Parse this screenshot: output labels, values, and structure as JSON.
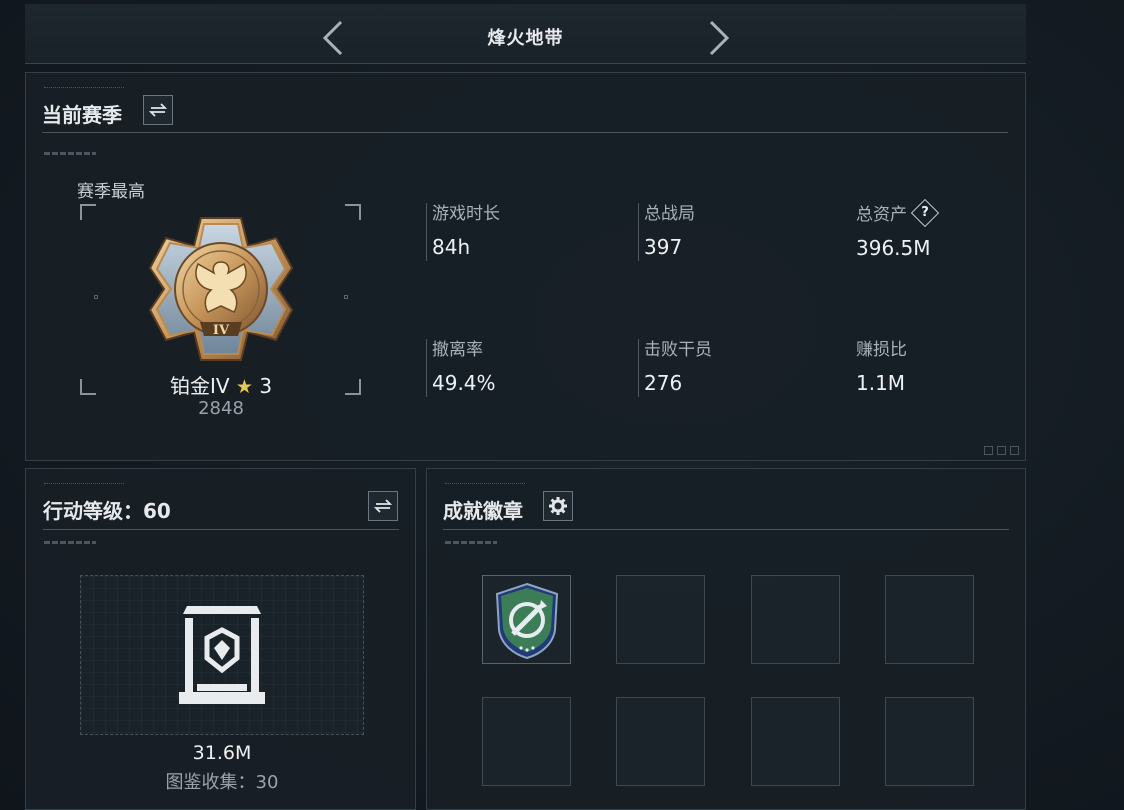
{
  "header": {
    "title": "烽火地带",
    "prev_icon": "chevron-left-icon",
    "next_icon": "chevron-right-icon"
  },
  "season": {
    "title": "当前赛季",
    "swap_icon": "swap-icon",
    "best_label": "赛季最高",
    "rank": {
      "name": "铂金IV",
      "stars": "3",
      "score": "2848",
      "numeral": "IV",
      "medal_icon": "platinum-eagle-medal-icon"
    },
    "stats": [
      {
        "label": "游戏时长",
        "value": "84h"
      },
      {
        "label": "总战局",
        "value": "397"
      },
      {
        "label": "总资产",
        "value": "396.5M",
        "help_icon": "question-icon",
        "help_text": "?"
      },
      {
        "label": "撤离率",
        "value": "49.4%"
      },
      {
        "label": "击败干员",
        "value": "276"
      },
      {
        "label": "赚损比",
        "value": "1.1M"
      }
    ]
  },
  "action_level": {
    "title": "行动等级：60",
    "swap_icon": "swap-icon",
    "collection_value": "31.6M",
    "collection_label": "图鉴收集：30",
    "collection_icon": "collection-display-case-icon"
  },
  "achievements": {
    "title": "成就徽章",
    "settings_icon": "gear-icon",
    "badges": [
      {
        "filled": true,
        "icon": "shield-badge-icon"
      },
      {
        "filled": false
      },
      {
        "filled": false
      },
      {
        "filled": false
      },
      {
        "filled": false
      },
      {
        "filled": false
      },
      {
        "filled": false
      },
      {
        "filled": false
      }
    ]
  },
  "colors": {
    "accent_gold": "#e6c75a",
    "badge_green": "#3f8a5a",
    "badge_blue": "#2c4a86"
  }
}
